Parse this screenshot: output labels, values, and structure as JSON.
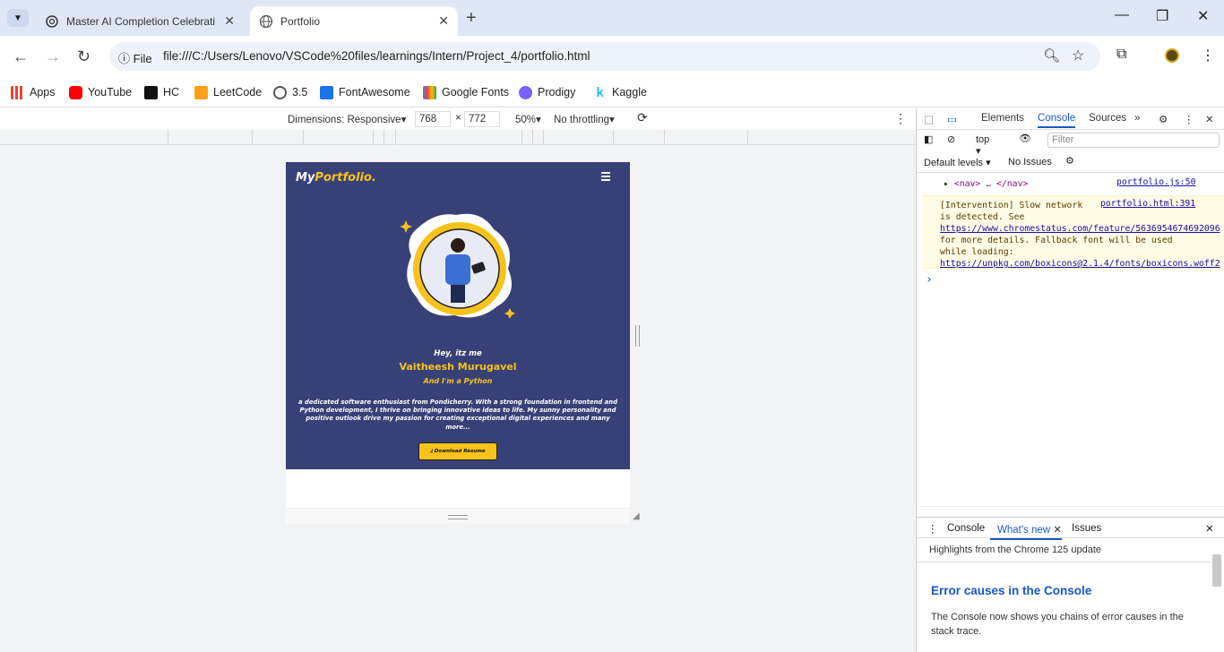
{
  "browser": {
    "tabs": [
      {
        "title": "Master AI Completion Celebrati"
      },
      {
        "title": "Portfolio"
      }
    ],
    "new_tab": "+",
    "omnibox": {
      "scheme_label": "File",
      "url": "file:///C:/Users/Lenovo/VSCode%20files/learnings/Intern/Project_4/portfolio.html"
    },
    "bookmarks": [
      {
        "label": "Apps",
        "color": "#e94235"
      },
      {
        "label": "YouTube",
        "color": "#ff0000"
      },
      {
        "label": "HC",
        "color": "#111111"
      },
      {
        "label": "LeetCode",
        "color": "#ffa116"
      },
      {
        "label": "3.5",
        "color": "#555555"
      },
      {
        "label": "FontAwesome",
        "color": "#1a73e8"
      },
      {
        "label": "Google Fonts",
        "color": "#34a853"
      },
      {
        "label": "Prodigy",
        "color": "#7b61ff"
      },
      {
        "label": "Kaggle",
        "color": "#20beff"
      }
    ]
  },
  "device_toolbar": {
    "dimensions": "Dimensions: Responsive",
    "width": "768",
    "times": "×",
    "height": "772",
    "zoom": "50%",
    "throttle": "No throttling"
  },
  "site": {
    "logo_a": "My",
    "logo_b": "Portfolio.",
    "greeting": "Hey, itz me",
    "name": "Vaitheesh Murugavel",
    "role": "And I'm a Python",
    "bio": "a dedicated software enthusiast from Pondicherry. With a strong foundation in frontend and Python development, I thrive on bringing innovative ideas to life. My sunny personality and positive outlook drive my passion for creating exceptional digital experiences and many more...",
    "download": "Download Resume",
    "accent": "#f7c21b",
    "bg": "#384177"
  },
  "devtools": {
    "tabs": [
      "Elements",
      "Console",
      "Sources"
    ],
    "context": "top",
    "filter_placeholder": "Filter",
    "levels": "Default levels",
    "issues": "No Issues",
    "log": {
      "nav_source": "portfolio.js:50",
      "nav_text": "<nav> … </nav>",
      "warn_source": "portfolio.html:391",
      "warn_line1": "[Intervention] Slow network",
      "warn_line2": "is detected. See",
      "warn_link1": "https://www.chromestatus.com/feature/5636954674692096",
      "warn_line3": "for more details. Fallback font will be used",
      "warn_line4": "while loading:",
      "warn_link2": "https://unpkg.com/boxicons@2.1.4/fonts/boxicons.woff2",
      "prompt": "›"
    },
    "drawer": {
      "tabs": [
        "Console",
        "What's new",
        "Issues"
      ],
      "highlight": "Highlights from the Chrome 125 update",
      "title": "Error causes in the Console",
      "text": "The Console now shows you chains of error causes in the stack trace."
    }
  }
}
